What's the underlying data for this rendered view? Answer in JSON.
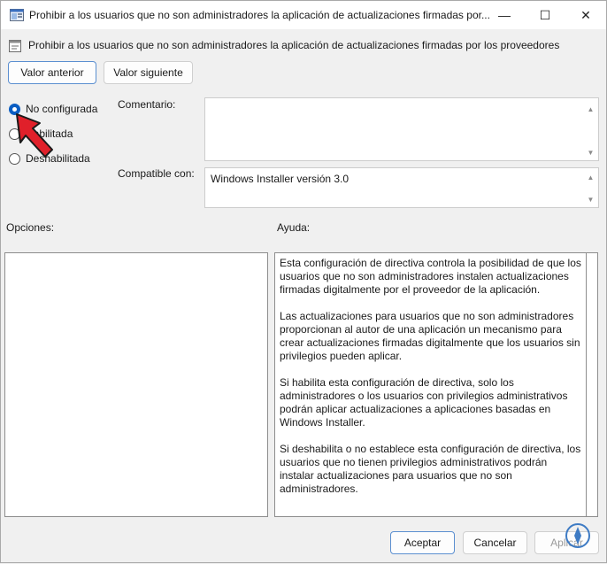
{
  "window": {
    "title": "Prohibir a los usuarios que no son administradores la aplicación de actualizaciones firmadas por...",
    "controls": {
      "minimize": "—",
      "maximize": "☐",
      "close": "✕"
    }
  },
  "policy": {
    "title": "Prohibir a los usuarios que no son administradores la aplicación de actualizaciones firmadas por los proveedores"
  },
  "nav": {
    "prev_label": "Valor anterior",
    "next_label": "Valor siguiente"
  },
  "state": {
    "options": [
      {
        "label": "No configurada",
        "checked": true
      },
      {
        "label": "Habilitada",
        "checked": false
      },
      {
        "label": "Deshabilitada",
        "checked": false
      }
    ]
  },
  "comment": {
    "label": "Comentario:",
    "value": ""
  },
  "compat": {
    "label": "Compatible con:",
    "value": "Windows Installer versión 3.0"
  },
  "options_panel": {
    "label": "Opciones:"
  },
  "help_panel": {
    "label": "Ayuda:",
    "paragraphs": [
      "Esta configuración de directiva controla la posibilidad de que los usuarios que no son administradores instalen actualizaciones firmadas digitalmente por el proveedor de la aplicación.",
      "Las actualizaciones para usuarios que no son administradores proporcionan al autor de una aplicación un mecanismo para crear actualizaciones firmadas digitalmente que los usuarios sin privilegios pueden aplicar.",
      "Si habilita esta configuración de directiva, solo los administradores o los usuarios con privilegios administrativos podrán aplicar actualizaciones a aplicaciones basadas en Windows Installer.",
      "Si deshabilita o no establece esta configuración de directiva, los usuarios que no tienen privilegios administrativos podrán instalar actualizaciones para usuarios que no son administradores."
    ]
  },
  "footer": {
    "ok_label": "Aceptar",
    "cancel_label": "Cancelar",
    "apply_label": "Aplicar"
  },
  "colors": {
    "accent": "#0a5dc2",
    "pointer_arrow": "#e0202a"
  }
}
